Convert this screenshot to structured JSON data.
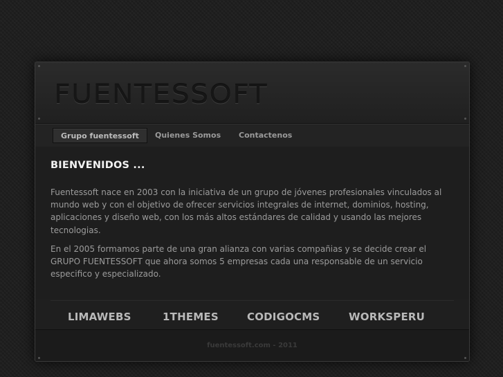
{
  "header": {
    "logo_text": "FUENTESSOFT"
  },
  "nav": {
    "items": [
      {
        "label": "Grupo fuentessoft"
      },
      {
        "label": "Quienes Somos"
      },
      {
        "label": "Contactenos"
      }
    ]
  },
  "main": {
    "title": "BIENVENIDOS ...",
    "paragraphs": [
      "Fuentessoft nace en 2003 con la iniciativa de un grupo de jóvenes profesionales vinculados al mundo web y con el objetivo de ofrecer servicios integrales de internet, dominios, hosting, aplicaciones y diseño web, con los más altos estándares de calidad y usando las mejores tecnologias.",
      "En el 2005 formamos parte de una gran alianza con varias compañias y se decide crear el GRUPO FUENTESSOFT que ahora somos 5 empresas cada una responsable de un servicio especifico y especializado."
    ]
  },
  "brands": [
    {
      "label": "LIMAWEBS"
    },
    {
      "label": "1THEMES"
    },
    {
      "label": "CODIGOCMS"
    },
    {
      "label": "WORKSPERU"
    }
  ],
  "footer": {
    "text": "fuentessoft.com - 2011"
  }
}
